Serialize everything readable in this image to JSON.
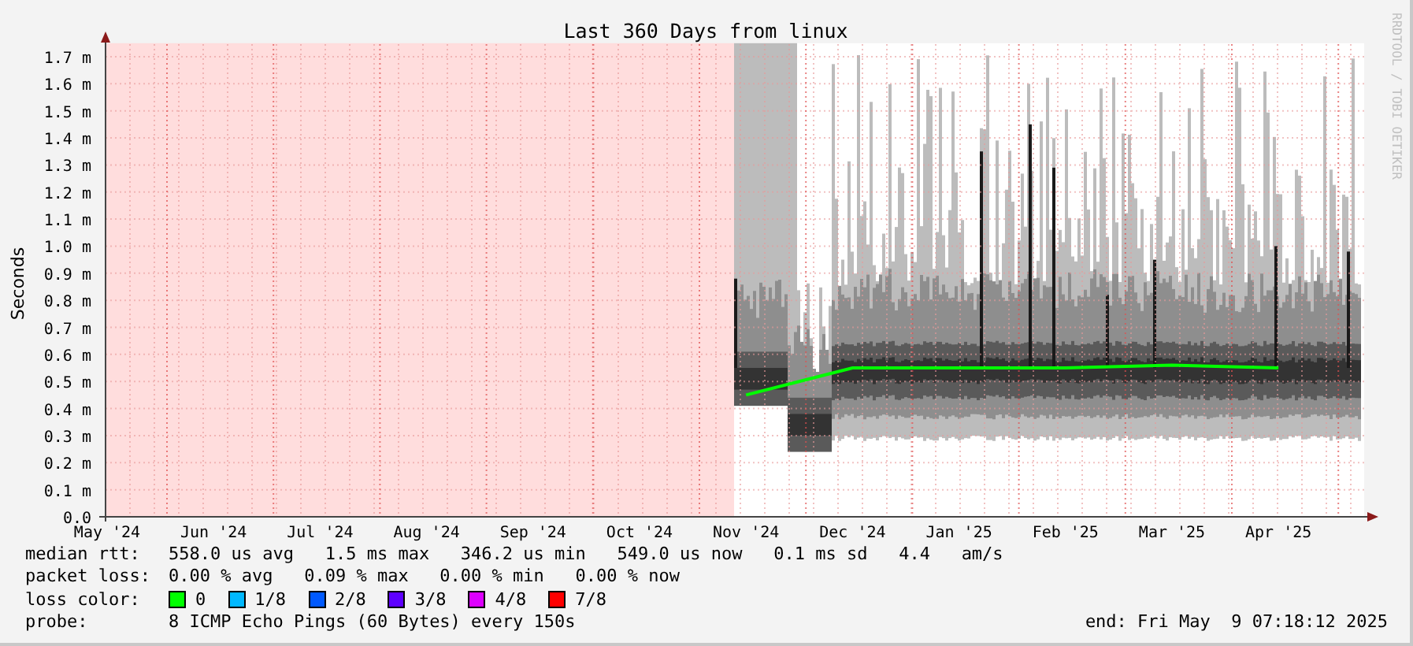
{
  "watermark": "RRDTOOL / TOBI OETIKER",
  "chart": {
    "chart_data": {
      "type": "line",
      "title": "Last 360 Days from linux",
      "ylabel": "Seconds",
      "categories": [
        "May '24",
        "Jun '24",
        "Jul '24",
        "Aug '24",
        "Sep '24",
        "Oct '24",
        "Nov '24",
        "Dec '24",
        "Jan '25",
        "Feb '25",
        "Mar '25",
        "Apr '25"
      ],
      "series": [
        {
          "color": "#00ff00",
          "values": [
            null,
            null,
            null,
            null,
            null,
            null,
            0.45,
            0.55,
            0.55,
            0.55,
            0.56,
            0.55
          ]
        }
      ],
      "ylim": [
        0,
        1.75
      ],
      "grid": true,
      "yticks": [
        {
          "value": 0,
          "label": "0.0"
        },
        {
          "value": 0.1,
          "label": "0.1 m"
        },
        {
          "value": 0.2,
          "label": "0.2 m"
        },
        {
          "value": 0.3,
          "label": "0.3 m"
        },
        {
          "value": 0.4,
          "label": "0.4 m"
        },
        {
          "value": 0.5,
          "label": "0.5 m"
        },
        {
          "value": 0.6,
          "label": "0.6 m"
        },
        {
          "value": 0.7,
          "label": "0.7 m"
        },
        {
          "value": 0.8,
          "label": "0.8 m"
        },
        {
          "value": 0.9,
          "label": "0.9 m"
        },
        {
          "value": 1.0,
          "label": "1.0 m"
        },
        {
          "value": 1.1,
          "label": "1.1 m"
        },
        {
          "value": 1.2,
          "label": "1.2 m"
        },
        {
          "value": 1.3,
          "label": "1.3 m"
        },
        {
          "value": 1.4,
          "label": "1.4 m"
        },
        {
          "value": 1.5,
          "label": "1.5 m"
        },
        {
          "value": 1.6,
          "label": "1.6 m"
        },
        {
          "value": 1.7,
          "label": "1.7 m"
        }
      ]
    }
  },
  "legend": [
    {
      "label": "median rtt:",
      "text": "558.0 us avg   1.5 ms max   346.2 us min   549.0 us now   0.1 ms sd   4.4   am/s"
    },
    {
      "label": "packet loss:",
      "text": "0.00 % avg   0.09 % max   0.00 % min   0.00 % now"
    }
  ],
  "loss_colors": {
    "label": "loss color:",
    "items": [
      {
        "label": "0",
        "color": "#00ff00"
      },
      {
        "label": "1/8",
        "color": "#00b8ff"
      },
      {
        "label": "2/8",
        "color": "#0059ff"
      },
      {
        "label": "3/8",
        "color": "#5e00ff"
      },
      {
        "label": "4/8",
        "color": "#dd00ff"
      },
      {
        "label": "7/8",
        "color": "#ff0000"
      }
    ]
  },
  "probe": {
    "label": "probe:",
    "text": "8 ICMP Echo Pings (60 Bytes) every 150s"
  },
  "end": "end: Fri May  9 07:18:12 2025"
}
